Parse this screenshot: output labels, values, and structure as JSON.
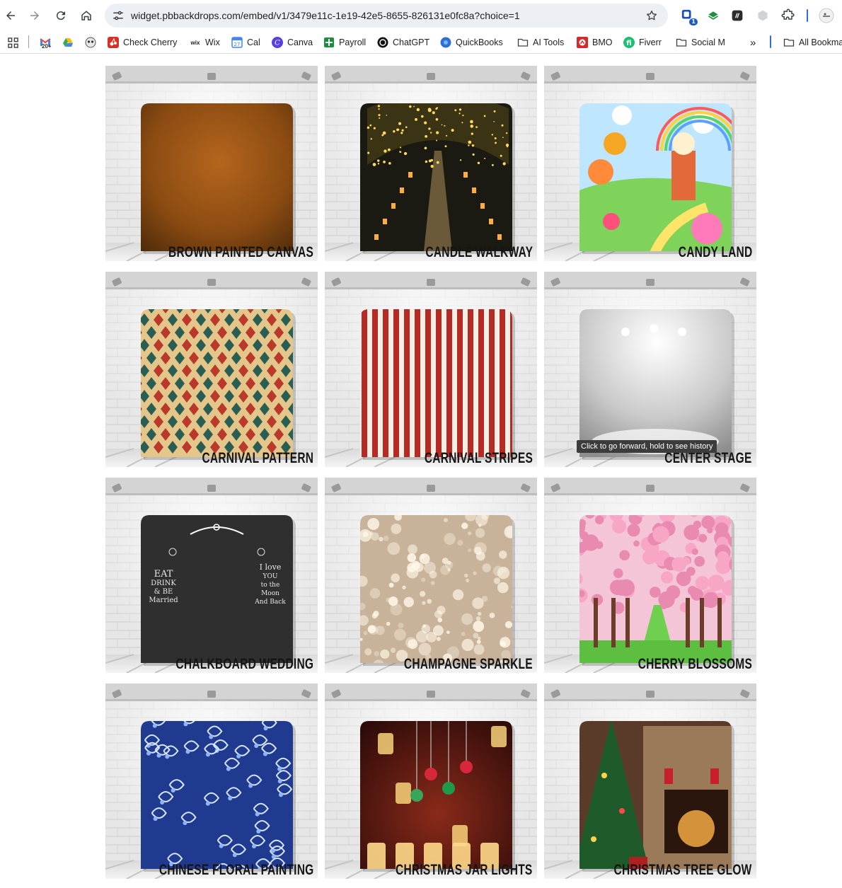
{
  "browser": {
    "url": "widget.pbbackdrops.com/embed/v1/3479e11c-1e19-42e5-8655-826131e0fc8a?choice=1",
    "extension_badge": "1",
    "tooltip": "Click to go forward, hold to see history"
  },
  "bookmarks": [
    {
      "label": "",
      "icon": "apps-grid-icon"
    },
    {
      "label": "",
      "icon": "gmail-icon",
      "badge": "20+"
    },
    {
      "label": "",
      "icon": "google-drive-icon"
    },
    {
      "label": "",
      "icon": "owl-icon"
    },
    {
      "label": "Check Cherry",
      "icon": "check-cherry-icon"
    },
    {
      "label": "Wix",
      "icon": "wix-icon"
    },
    {
      "label": "Cal",
      "icon": "calendar-icon",
      "badge": "27"
    },
    {
      "label": "Canva",
      "icon": "canva-icon"
    },
    {
      "label": "Payroll",
      "icon": "payroll-icon"
    },
    {
      "label": "ChatGPT",
      "icon": "chatgpt-icon"
    },
    {
      "label": "QuickBooks",
      "icon": "quickbooks-icon"
    },
    {
      "label": "AI Tools",
      "icon": "folder-icon"
    },
    {
      "label": "BMO",
      "icon": "bmo-icon"
    },
    {
      "label": "Fiverr",
      "icon": "fiverr-icon"
    },
    {
      "label": "Social M",
      "icon": "folder-icon"
    },
    {
      "label": "»",
      "icon": "overflow-icon"
    },
    {
      "label": "All Bookma",
      "icon": "folder-icon"
    }
  ],
  "backdrops": [
    {
      "name": "BROWN PAINTED CANVAS",
      "style": "brown"
    },
    {
      "name": "CANDLE WALKWAY",
      "style": "candle"
    },
    {
      "name": "CANDY LAND",
      "style": "candy"
    },
    {
      "name": "CARNIVAL PATTERN",
      "style": "harlequin"
    },
    {
      "name": "CARNIVAL STRIPES",
      "style": "stripes"
    },
    {
      "name": "CENTER STAGE",
      "style": "stage"
    },
    {
      "name": "CHALKBOARD WEDDING",
      "style": "chalk"
    },
    {
      "name": "CHAMPAGNE SPARKLE",
      "style": "sparkle"
    },
    {
      "name": "CHERRY BLOSSOMS",
      "style": "cherry"
    },
    {
      "name": "CHINESE FLORAL PAINTING",
      "style": "floral"
    },
    {
      "name": "CHRISTMAS JAR LIGHTS",
      "style": "jars"
    },
    {
      "name": "CHRISTMAS TREE GLOW",
      "style": "tree"
    }
  ],
  "chalkboard_text": {
    "left": [
      "EAT",
      "DRINK",
      "& BE",
      "Married"
    ],
    "right": [
      "I love",
      "YOU",
      "to the",
      "Moon",
      "And Back"
    ]
  },
  "colors": {
    "accent": "#1a73e8",
    "label": "#151515",
    "brick": "#e7e7e7"
  }
}
